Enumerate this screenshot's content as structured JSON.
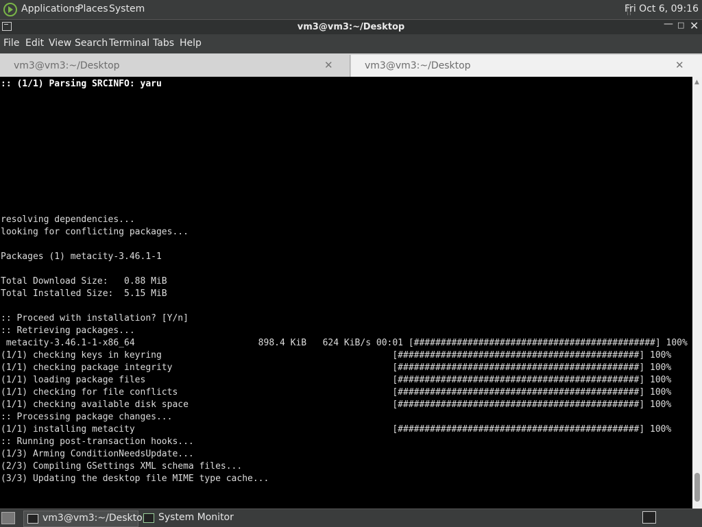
{
  "top_panel": {
    "menus": [
      "Applications",
      "Places",
      "System"
    ],
    "clock": "Fri Oct  6, 09:16"
  },
  "window": {
    "title": "vm3@vm3:~/Desktop"
  },
  "menubar": [
    "File",
    "Edit",
    "View",
    "Search",
    "Terminal",
    "Tabs",
    "Help"
  ],
  "tabs": [
    {
      "label": "vm3@vm3:~/Desktop"
    },
    {
      "label": "vm3@vm3:~/Desktop"
    }
  ],
  "terminal": {
    "header_line": ":: (1/1) Parsing SRCINFO: yaru",
    "lines": [
      "resolving dependencies...",
      "looking for conflicting packages...",
      "",
      "Packages (1) metacity-3.46.1-1",
      "",
      "Total Download Size:   0.88 MiB",
      "Total Installed Size:  5.15 MiB",
      "",
      ":: Proceed with installation? [Y/n]",
      ":: Retrieving packages...",
      " metacity-3.46.1-1-x86_64                       898.4 KiB   624 KiB/s 00:01 [#############################################] 100%",
      "(1/1) checking keys in keyring                                           [#############################################] 100%",
      "(1/1) checking package integrity                                         [#############################################] 100%",
      "(1/1) loading package files                                              [#############################################] 100%",
      "(1/1) checking for file conflicts                                        [#############################################] 100%",
      "(1/1) checking available disk space                                      [#############################################] 100%",
      ":: Processing package changes...",
      "(1/1) installing metacity                                                [#############################################] 100%",
      ":: Running post-transaction hooks...",
      "(1/3) Arming ConditionNeedsUpdate...",
      "(2/3) Compiling GSettings XML schema files...",
      "(3/3) Updating the desktop file MIME type cache..."
    ]
  },
  "taskbar": {
    "tasks": [
      {
        "label": "vm3@vm3:~/Desktop"
      },
      {
        "label": "System Monitor"
      }
    ]
  },
  "icons": {
    "logo": "gnome-foot-icon",
    "window": "terminal-icon",
    "close": "close-icon"
  }
}
